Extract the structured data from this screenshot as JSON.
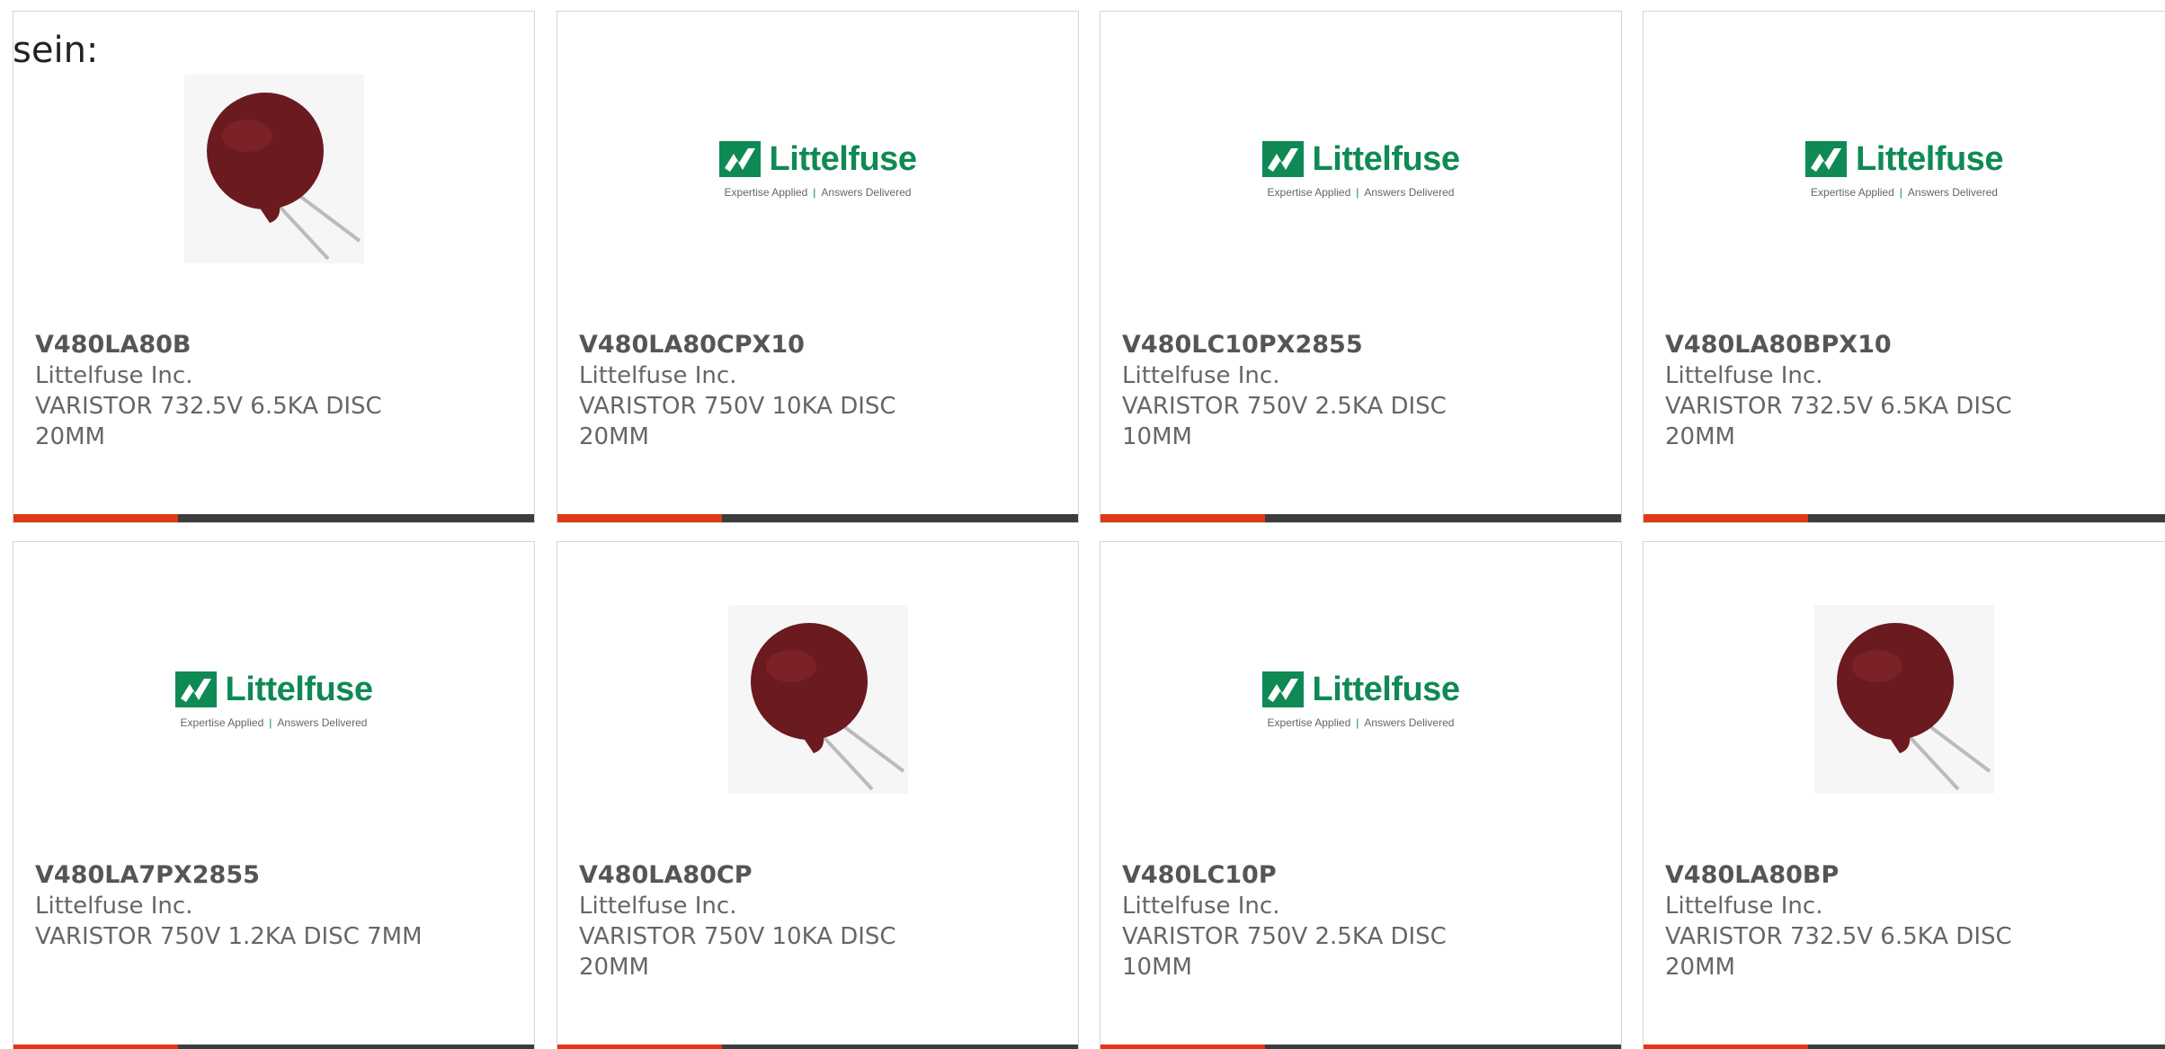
{
  "intro_text": "sein:",
  "colors": {
    "accent": "#dd3a15",
    "bar": "#3c3c3c",
    "logo_green": "#0f8a55",
    "varistor": "#6b1a1f"
  },
  "logo": {
    "brand": "Littelfuse",
    "tagline_left": "Expertise Applied",
    "tagline_sep": "|",
    "tagline_right": "Answers Delivered"
  },
  "products": [
    {
      "part": "V480LA80B",
      "maker": "Littelfuse Inc.",
      "desc_1": "VARISTOR 732.5V 6.5KA DISC",
      "desc_2": "20MM",
      "image": "varistor-photo"
    },
    {
      "part": "V480LA80CPX10",
      "maker": "Littelfuse Inc.",
      "desc_1": "VARISTOR 750V 10KA DISC",
      "desc_2": "20MM",
      "image": "littelfuse-logo"
    },
    {
      "part": "V480LC10PX2855",
      "maker": "Littelfuse Inc.",
      "desc_1": "VARISTOR 750V 2.5KA DISC",
      "desc_2": "10MM",
      "image": "littelfuse-logo"
    },
    {
      "part": "V480LA80BPX10",
      "maker": "Littelfuse Inc.",
      "desc_1": "VARISTOR 732.5V 6.5KA DISC",
      "desc_2": "20MM",
      "image": "littelfuse-logo"
    },
    {
      "part": "V480LA7PX2855",
      "maker": "Littelfuse Inc.",
      "desc_1": "VARISTOR 750V 1.2KA DISC 7MM",
      "desc_2": "",
      "image": "littelfuse-logo"
    },
    {
      "part": "V480LA80CP",
      "maker": "Littelfuse Inc.",
      "desc_1": "VARISTOR 750V 10KA DISC",
      "desc_2": "20MM",
      "image": "varistor-photo"
    },
    {
      "part": "V480LC10P",
      "maker": "Littelfuse Inc.",
      "desc_1": "VARISTOR 750V 2.5KA DISC",
      "desc_2": "10MM",
      "image": "littelfuse-logo"
    },
    {
      "part": "V480LA80BP",
      "maker": "Littelfuse Inc.",
      "desc_1": "VARISTOR 732.5V 6.5KA DISC",
      "desc_2": "20MM",
      "image": "varistor-photo"
    }
  ]
}
